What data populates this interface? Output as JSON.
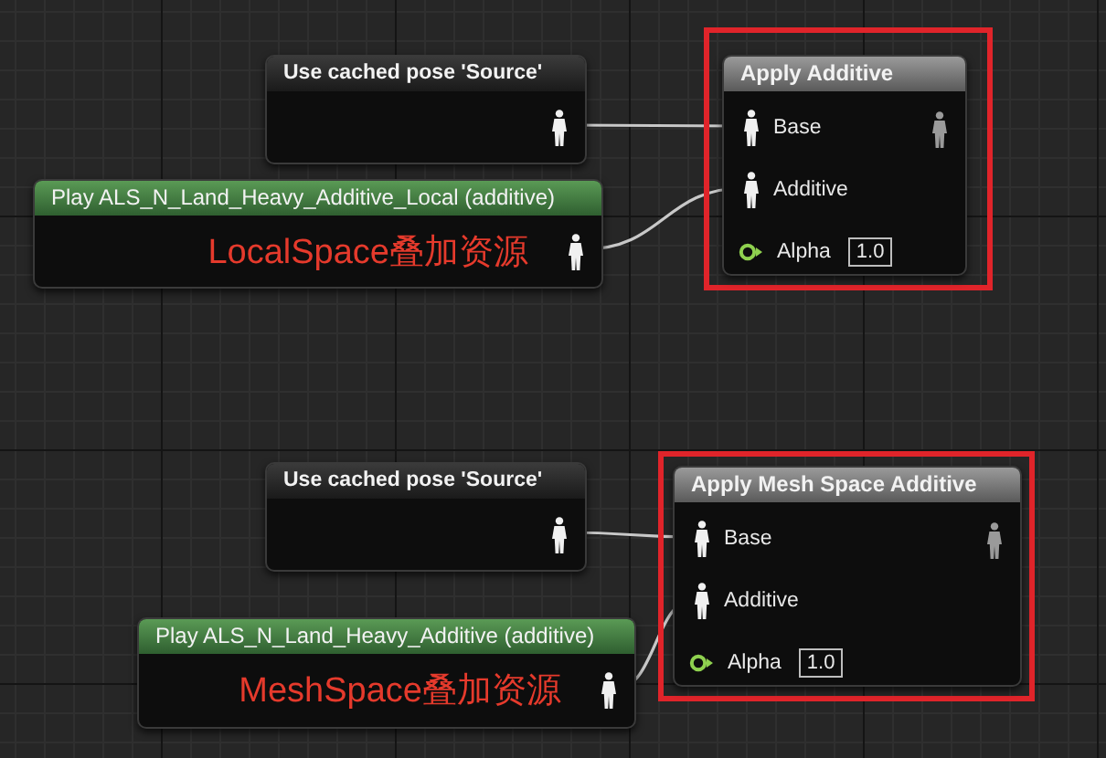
{
  "graphs": [
    {
      "highlighted": true,
      "cached_pose": {
        "title": "Use cached pose 'Source'"
      },
      "play_node": {
        "title": "Play ALS_N_Land_Heavy_Additive_Local (additive)",
        "annotation": "LocalSpace叠加资源"
      },
      "blend_node": {
        "title": "Apply Additive",
        "pins": [
          {
            "kind": "pose",
            "label": "Base"
          },
          {
            "kind": "pose",
            "label": "Additive"
          },
          {
            "kind": "float",
            "label": "Alpha",
            "value": "1.0"
          }
        ]
      }
    },
    {
      "highlighted": true,
      "cached_pose": {
        "title": "Use cached pose 'Source'"
      },
      "play_node": {
        "title": "Play ALS_N_Land_Heavy_Additive (additive)",
        "annotation": "MeshSpace叠加资源"
      },
      "blend_node": {
        "title": "Apply Mesh Space Additive",
        "pins": [
          {
            "kind": "pose",
            "label": "Base"
          },
          {
            "kind": "pose",
            "label": "Additive"
          },
          {
            "kind": "float",
            "label": "Alpha",
            "value": "1.0"
          }
        ]
      }
    }
  ]
}
